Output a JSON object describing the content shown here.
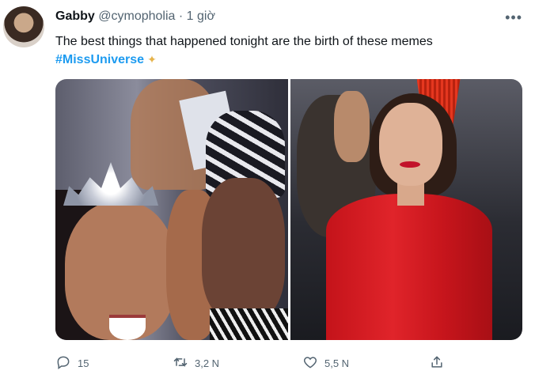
{
  "tweet": {
    "display_name": "Gabby",
    "handle": "@cymopholia",
    "separator": "·",
    "time": "1 giờ",
    "text": "The best things that happened tonight are the birth of these memes",
    "hashtag": "#MissUniverse",
    "more_icon": "more-icon"
  },
  "actions": {
    "reply_count": "15",
    "retweet_count": "3,2 N",
    "like_count": "5,5 N"
  },
  "colors": {
    "accent": "#1d9bf0",
    "muted": "#536471",
    "text": "#0f1419"
  }
}
